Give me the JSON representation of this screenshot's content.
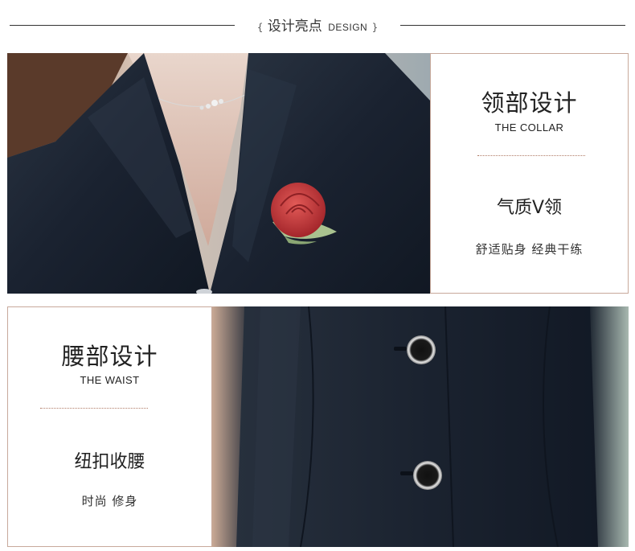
{
  "header": {
    "brace_open": "{",
    "title_cn": "设计亮点",
    "title_en": "DESIGN",
    "brace_close": "}"
  },
  "sections": [
    {
      "title_cn": "领部设计",
      "title_en": "THE COLLAR",
      "feature": "气质V领",
      "subtitle": "舒适贴身 经典干练",
      "image": "collar-closeup-with-rose-brooch"
    },
    {
      "title_cn": "腰部设计",
      "title_en": "THE WAIST",
      "feature": "纽扣收腰",
      "subtitle": "时尚 修身",
      "image": "waist-closeup-with-buttons"
    }
  ],
  "colors": {
    "panel_border": "#c8a99b",
    "divider_dots": "#b07a66",
    "fabric": "#1b2431",
    "rose": "#c8383b",
    "leaf": "#a9c28f"
  }
}
